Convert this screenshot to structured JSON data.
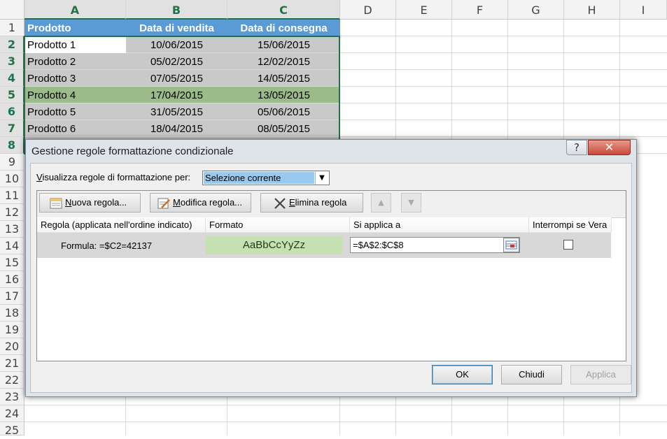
{
  "columns": [
    "A",
    "B",
    "C",
    "D",
    "E",
    "F",
    "G",
    "H",
    "I"
  ],
  "rows": [
    "1",
    "2",
    "3",
    "4",
    "5",
    "6",
    "7",
    "8",
    "9",
    "10",
    "11",
    "12",
    "13",
    "14",
    "15",
    "16",
    "17",
    "18",
    "19",
    "20",
    "21",
    "22",
    "23",
    "24",
    "25"
  ],
  "table": {
    "headers": [
      "Prodotto",
      "Data di vendita",
      "Data di consegna"
    ],
    "rows": [
      [
        "Prodotto 1",
        "10/06/2015",
        "15/06/2015"
      ],
      [
        "Prodotto 2",
        "05/02/2015",
        "12/02/2015"
      ],
      [
        "Prodotto 3",
        "07/05/2015",
        "14/05/2015"
      ],
      [
        "Prodotto 4",
        "17/04/2015",
        "13/05/2015"
      ],
      [
        "Prodotto 5",
        "31/05/2015",
        "05/06/2015"
      ],
      [
        "Prodotto 6",
        "18/04/2015",
        "08/05/2015"
      ]
    ]
  },
  "dialog": {
    "title": "Gestione regole formattazione condizionale",
    "show_rules_label_key": "V",
    "show_rules_label_rest": "isualizza regole di formattazione per:",
    "show_rules_value": "Selezione corrente",
    "buttons": {
      "new_key": "N",
      "new_rest": "uova regola...",
      "edit_key": "M",
      "edit_rest": "odifica regola...",
      "delete_key": "E",
      "delete_rest": "limina regola",
      "ok": "OK",
      "close": "Chiudi",
      "apply": "Applica"
    },
    "columns": {
      "rule": "Regola (applicata nell'ordine indicato)",
      "format": "Formato",
      "applies_to": "Si applica a",
      "stop_if_true": "Interrompi se Vera"
    },
    "rule": {
      "formula": "Formula: =$C2=42137",
      "preview": "AaBbCcYyZz",
      "range": "=$A$2:$C$8",
      "stop_if_true": false
    },
    "help_glyph": "?",
    "close_glyph": "✕"
  },
  "colors": {
    "header_fill": "#5b9bd5",
    "row_fill": "#c9c9c9",
    "highlight_fill": "#9bbb8a",
    "preview_fill": "#c6e0b4",
    "selection": "#217346"
  }
}
